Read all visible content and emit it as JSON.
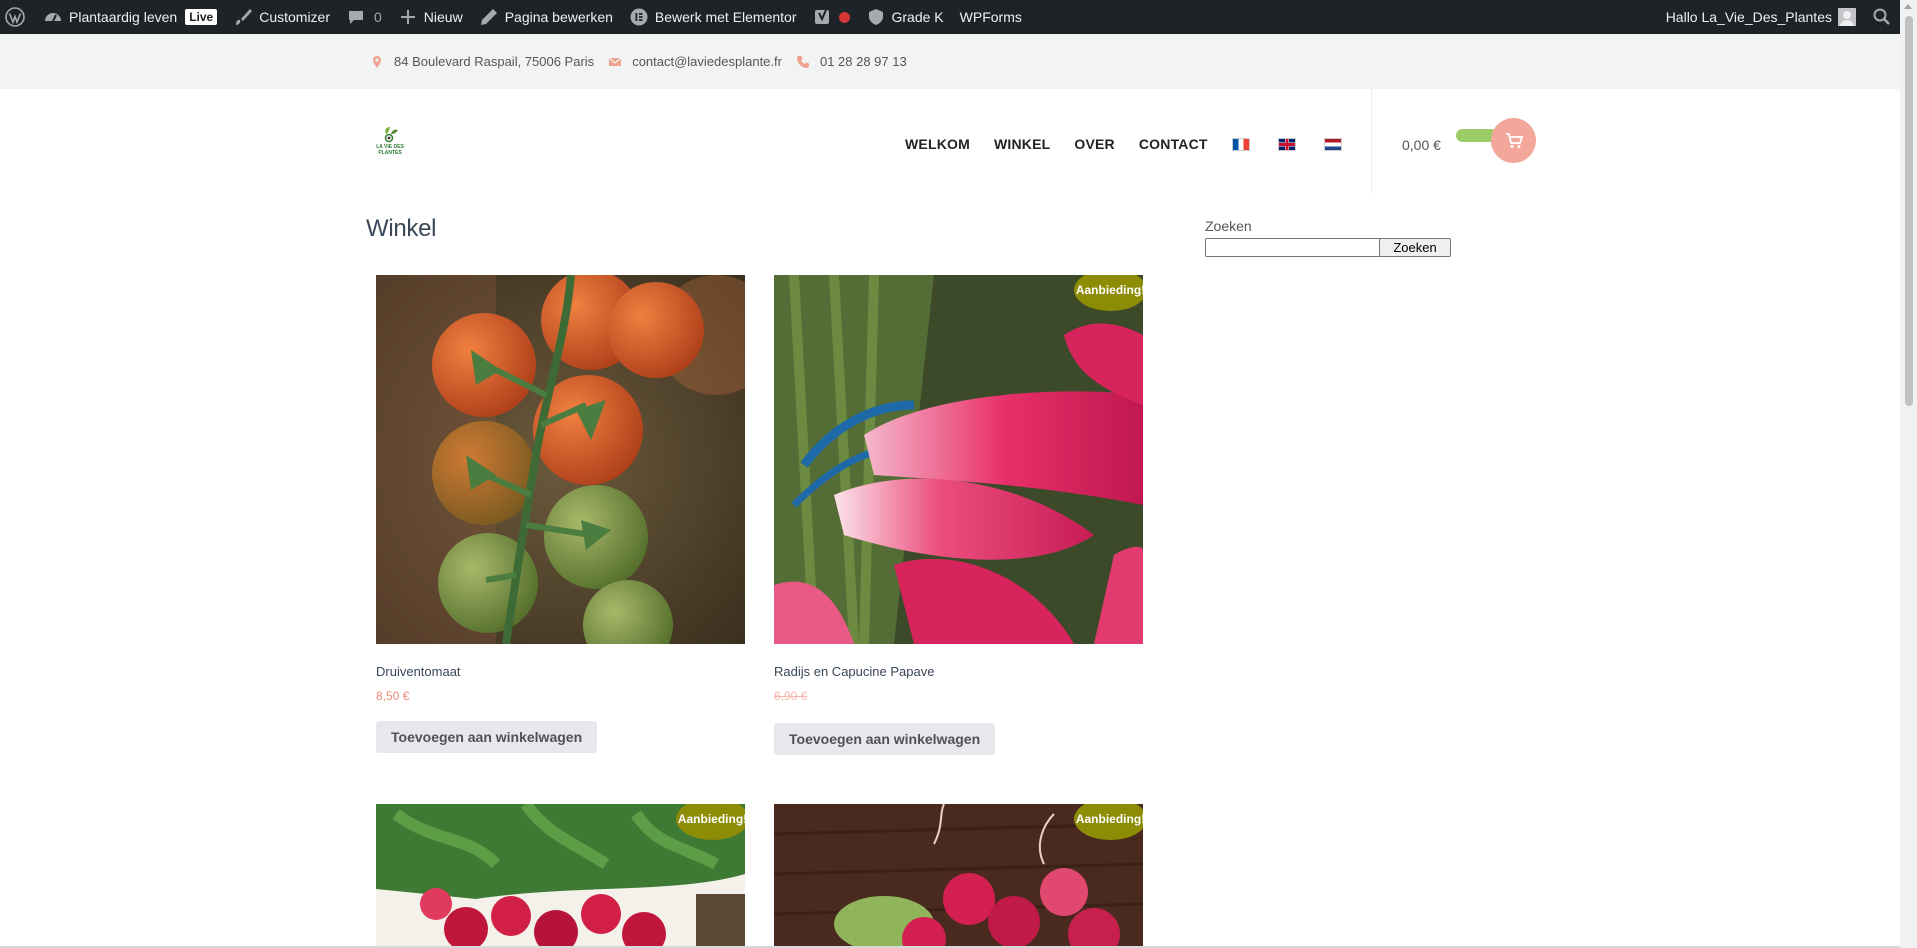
{
  "admin_bar": {
    "site_name": "Plantaardig leven",
    "live_badge": "Live",
    "customizer": "Customizer",
    "comments_count": "0",
    "new": "Nieuw",
    "edit_page": "Pagina bewerken",
    "elementor": "Bewerk met Elementor",
    "grade": "Grade K",
    "wpforms": "WPForms",
    "greeting": "Hallo La_Vie_Des_Plantes"
  },
  "topbar": {
    "address": "84 Boulevard Raspail, 75006 Paris",
    "email": "contact@laviedesplante.fr",
    "phone": "01 28 28 97 13"
  },
  "header": {
    "logo_text_1": "LA VIE DES",
    "logo_text_2": "PLANTES",
    "nav": [
      "WELKOM",
      "WINKEL",
      "OVER",
      "CONTACT"
    ],
    "cart_total": "0,00 €"
  },
  "main": {
    "title": "Winkel",
    "products": [
      {
        "name": "Druiventomaat",
        "price": "8,50 €",
        "button": "Toevoegen aan winkelwagen",
        "sale": false
      },
      {
        "name": "Radijs en Capucine Papave",
        "price": "6,90 €",
        "button": "Toevoegen aan winkelwagen",
        "sale": true,
        "badge": "Aanbieding!"
      }
    ],
    "row2_badges": [
      "Aanbieding!",
      "Aanbieding!"
    ]
  },
  "sidebar": {
    "search_label": "Zoeken",
    "search_button": "Zoeken"
  },
  "colors": {
    "admin_bar": "#1d2327",
    "accent_salmon": "#f2a79a",
    "sale_badge": "#8d8c05",
    "cart_green": "#9ccc65",
    "topbar_bg": "#f2f4f3"
  }
}
